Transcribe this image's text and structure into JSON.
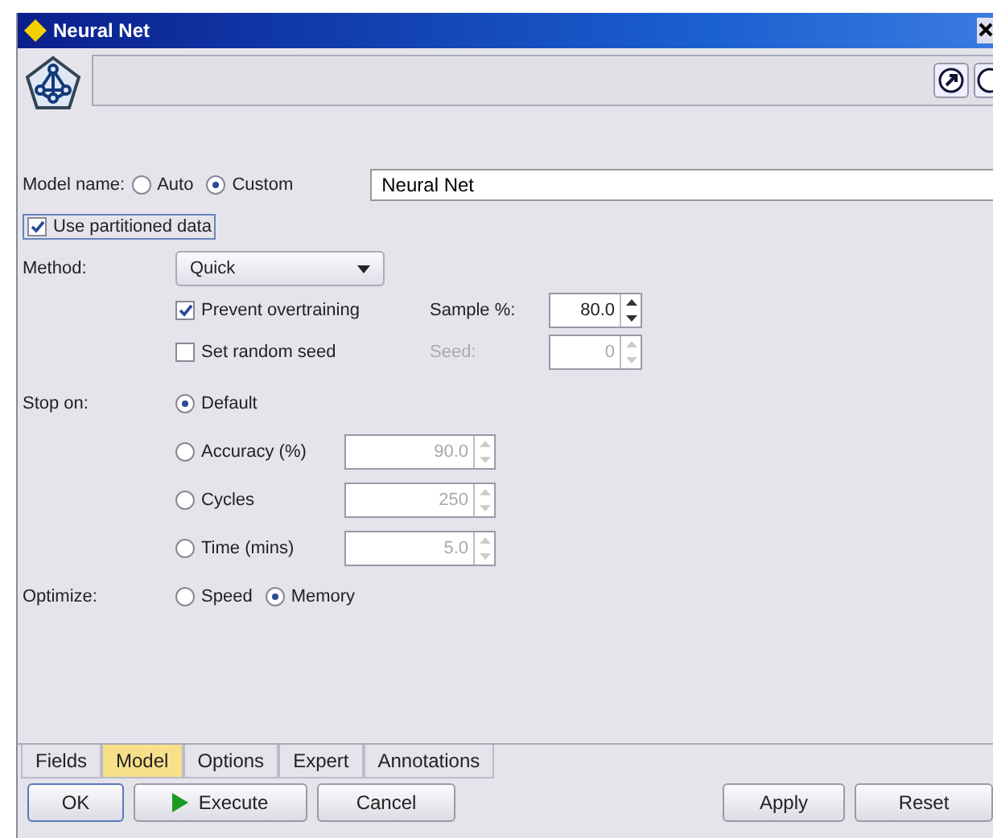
{
  "window": {
    "title": "Neural Net"
  },
  "model_name": {
    "label": "Model name:",
    "options": [
      {
        "label": "Auto",
        "selected": false
      },
      {
        "label": "Custom",
        "selected": true
      }
    ],
    "value": "Neural Net"
  },
  "use_partitioned": {
    "label": "Use partitioned data",
    "checked": true
  },
  "method": {
    "label": "Method:",
    "value": "Quick"
  },
  "prevent_overtraining": {
    "label": "Prevent overtraining",
    "checked": true,
    "field_label": "Sample %:",
    "value": "80.0",
    "disabled": false
  },
  "random_seed": {
    "label": "Set random seed",
    "checked": false,
    "field_label": "Seed:",
    "value": "0",
    "disabled": true
  },
  "stop_on": {
    "label": "Stop on:",
    "options": [
      {
        "label": "Default",
        "selected": true
      },
      {
        "label": "Accuracy (%)",
        "selected": false,
        "value": "90.0",
        "disabled": true
      },
      {
        "label": "Cycles",
        "selected": false,
        "value": "250",
        "disabled": true
      },
      {
        "label": "Time (mins)",
        "selected": false,
        "value": "5.0",
        "disabled": true
      }
    ]
  },
  "optimize": {
    "label": "Optimize:",
    "options": [
      {
        "label": "Speed",
        "selected": false
      },
      {
        "label": "Memory",
        "selected": true
      }
    ]
  },
  "tabs": [
    {
      "label": "Fields",
      "selected": false
    },
    {
      "label": "Model",
      "selected": true
    },
    {
      "label": "Options",
      "selected": false
    },
    {
      "label": "Expert",
      "selected": false
    },
    {
      "label": "Annotations",
      "selected": false
    }
  ],
  "buttons": [
    {
      "label": "OK",
      "kind": "default"
    },
    {
      "label": "Execute",
      "kind": "run"
    },
    {
      "label": "Cancel",
      "kind": "plain"
    },
    {
      "label": "Apply",
      "kind": "plain"
    },
    {
      "label": "Reset",
      "kind": "plain"
    }
  ]
}
